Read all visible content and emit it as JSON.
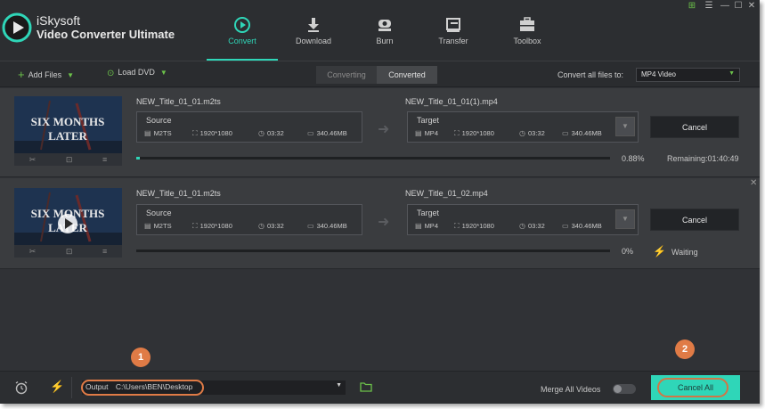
{
  "app": {
    "brand_line1": "iSkysoft",
    "brand_line2": "Video Converter Ultimate"
  },
  "nav": [
    {
      "label": "Convert",
      "icon": "convert-icon",
      "active": true
    },
    {
      "label": "Download",
      "icon": "download-icon",
      "active": false
    },
    {
      "label": "Burn",
      "icon": "burn-icon",
      "active": false
    },
    {
      "label": "Transfer",
      "icon": "transfer-icon",
      "active": false
    },
    {
      "label": "Toolbox",
      "icon": "toolbox-icon",
      "active": false
    }
  ],
  "toolbar": {
    "add_files": "Add Files",
    "load_dvd": "Load DVD",
    "tab_converting": "Converting",
    "tab_converted": "Converted",
    "convert_all_label": "Convert all files to:",
    "format": "MP4 Video"
  },
  "tasks": [
    {
      "source_name": "NEW_Title_01_01.m2ts",
      "target_name": "NEW_Title_01_01(1).mp4",
      "source": {
        "title": "Source",
        "format": "M2TS",
        "resolution": "1920*1080",
        "duration": "03:32",
        "size": "340.46MB"
      },
      "target": {
        "title": "Target",
        "format": "MP4",
        "resolution": "1920*1080",
        "duration": "03:32",
        "size": "340.46MB"
      },
      "cancel_label": "Cancel",
      "progress_pct": 0.88,
      "progress_text": "0.88%",
      "status": "Remaining:01:40:49"
    },
    {
      "source_name": "NEW_Title_01_01.m2ts",
      "target_name": "NEW_Title_01_02.mp4",
      "source": {
        "title": "Source",
        "format": "M2TS",
        "resolution": "1920*1080",
        "duration": "03:32",
        "size": "340.46MB"
      },
      "target": {
        "title": "Target",
        "format": "MP4",
        "resolution": "1920*1080",
        "duration": "03:32",
        "size": "340.46MB"
      },
      "cancel_label": "Cancel",
      "progress_pct": 0,
      "progress_text": "0%",
      "status": "Waiting"
    }
  ],
  "thumbnail_text": {
    "line1": "SIX MONTHS",
    "line2": "LATER"
  },
  "bottom": {
    "output_label": "Output",
    "output_path": "C:\\Users\\BEN\\Desktop",
    "merge_label": "Merge All Videos",
    "merge_on": false,
    "cancel_all": "Cancel All"
  },
  "badges": {
    "step1": "1",
    "step2": "2"
  },
  "colors": {
    "accent": "#2fd6b8",
    "green": "#6cc24a",
    "highlight": "#e07b46"
  }
}
